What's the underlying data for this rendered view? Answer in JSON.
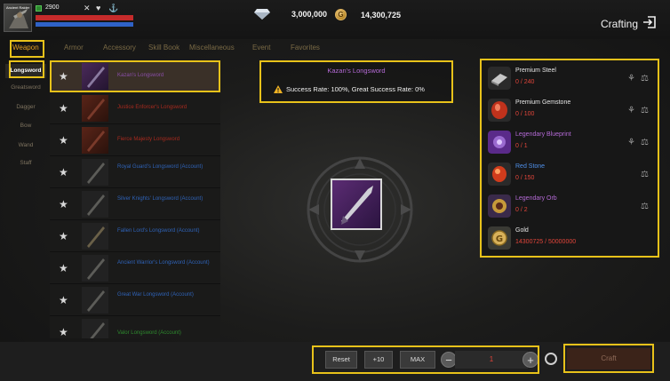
{
  "player": {
    "level": "2900",
    "avatar_tag": "Ancient Raider"
  },
  "currency": {
    "diamonds": "3,000,000",
    "gold": "14,300,725",
    "gold_icon_glyph": "G"
  },
  "header": {
    "title": "Crafting"
  },
  "tabs": [
    {
      "label": "Weapon",
      "active": true
    },
    {
      "label": "Armor"
    },
    {
      "label": "Accessory"
    },
    {
      "label": "Skill Book"
    },
    {
      "label": "Miscellaneous"
    },
    {
      "label": "Event"
    },
    {
      "label": "Favorites"
    }
  ],
  "subcategories": [
    {
      "label": "Longsword",
      "active": true
    },
    {
      "label": "Greatsword"
    },
    {
      "label": "Dagger"
    },
    {
      "label": "Bow"
    },
    {
      "label": "Wand"
    },
    {
      "label": "Staff"
    }
  ],
  "items": [
    {
      "name": "Kazan's Longsword",
      "color": "#8a4ea8",
      "thumb": "purple",
      "selected": true
    },
    {
      "name": "Justice Enforcer's Longsword",
      "color": "#a82a1e",
      "thumb": "red"
    },
    {
      "name": "Fierce Majesty Longsword",
      "color": "#a82a1e",
      "thumb": "red"
    },
    {
      "name": "Royal Guard's Longsword (Account)",
      "color": "#2f63b8",
      "thumb": "plain"
    },
    {
      "name": "Silver Knights' Longsword (Account)",
      "color": "#2f63b8",
      "thumb": "plain"
    },
    {
      "name": "Fallen Lord's Longsword (Account)",
      "color": "#2f63b8",
      "thumb": "plain"
    },
    {
      "name": "Ancient Warrior's Longsword (Account)",
      "color": "#2f63b8",
      "thumb": "plain"
    },
    {
      "name": "Great War Longsword (Account)",
      "color": "#2f63b8",
      "thumb": "plain"
    },
    {
      "name": "Valor Longsword (Account)",
      "color": "#2e8a2e",
      "thumb": "plain"
    }
  ],
  "selected": {
    "name": "Kazan's Longsword",
    "rate_text": "Success Rate: 100%, Great Success Rate: 0%"
  },
  "materials": [
    {
      "name": "Premium Steel",
      "count": "0 / 240",
      "name_color": "#e6e6e6",
      "icon": "steel-icon",
      "extra_icons": 2
    },
    {
      "name": "Premium Gemstone",
      "count": "0 / 100",
      "name_color": "#e6e6e6",
      "icon": "gemstone-icon",
      "extra_icons": 2
    },
    {
      "name": "Legendary Blueprint",
      "count": "0 / 1",
      "name_color": "#b46ad6",
      "icon": "blueprint-icon",
      "extra_icons": 2
    },
    {
      "name": "Red Stone",
      "count": "0 / 150",
      "name_color": "#4f8fe8",
      "icon": "red-stone-icon",
      "extra_icons": 1
    },
    {
      "name": "Legendary Orb",
      "count": "0 / 2",
      "name_color": "#b46ad6",
      "icon": "orb-icon",
      "extra_icons": 1
    },
    {
      "name": "Gold",
      "count": "14300725 / 50000000",
      "name_color": "#e6e6e6",
      "icon": "gold-icon",
      "extra_icons": 0
    }
  ],
  "controls": {
    "reset_label": "Reset",
    "plus10_label": "+10",
    "max_label": "MAX",
    "quantity": "1",
    "minus_glyph": "−",
    "plus_glyph": "+",
    "craft_label": "Craft"
  }
}
